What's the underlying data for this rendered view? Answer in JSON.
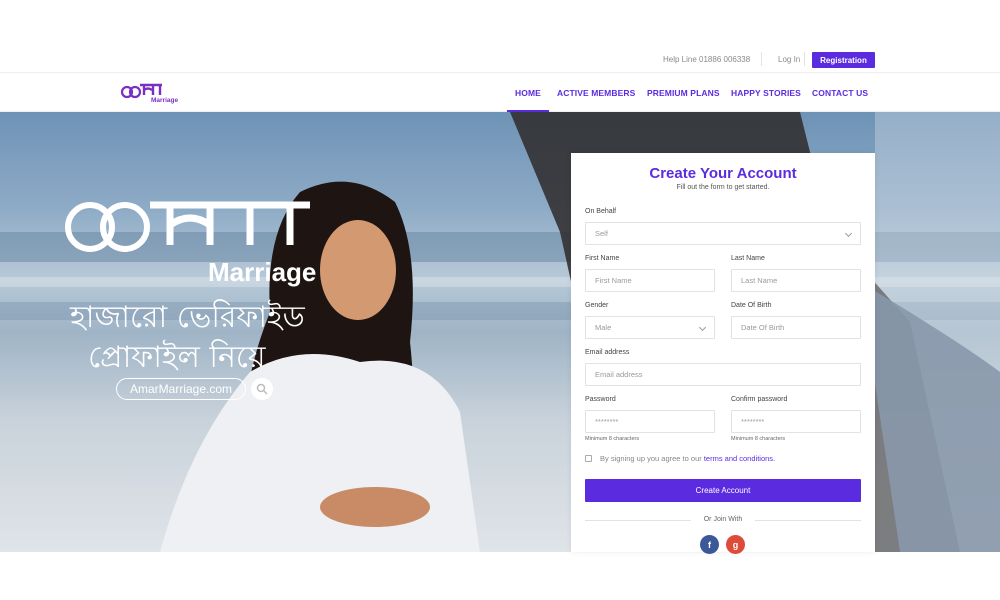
{
  "topbar": {
    "helpline": "Help Line 01886 006338",
    "login": "Log In",
    "register": "Registration"
  },
  "nav": {
    "items": [
      "HOME",
      "ACTIVE MEMBERS",
      "PREMIUM PLANS",
      "HAPPY STORIES",
      "CONTACT US"
    ],
    "active": "HOME"
  },
  "logo": {
    "text": "Marriage"
  },
  "hero": {
    "brand_line1": "Marriage",
    "tagline_line1": "হাজারো ভেরিফাইড",
    "tagline_line2": "প্রোফাইল নিয়ে",
    "url": "AmarMarriage.com"
  },
  "form": {
    "title": "Create Your Account",
    "subtitle": "Fill out the form to get started.",
    "on_behalf_label": "On Behalf",
    "on_behalf_value": "Self",
    "first_name_label": "First Name",
    "first_name_placeholder": "First Name",
    "last_name_label": "Last Name",
    "last_name_placeholder": "Last Name",
    "gender_label": "Gender",
    "gender_value": "Male",
    "dob_label": "Date Of Birth",
    "dob_placeholder": "Date Of Birth",
    "email_label": "Email address",
    "email_placeholder": "Email address",
    "password_label": "Password",
    "password_placeholder": "********",
    "password_hint": "Minimum 8 characters",
    "confirm_label": "Confirm password",
    "confirm_placeholder": "********",
    "confirm_hint": "Minimum 8 characters",
    "agree_text": "By signing up you agree to our",
    "terms_link": "terms and conditions.",
    "submit": "Create Account",
    "or_join": "Or Join With",
    "facebook": "f",
    "google": "g"
  },
  "colors": {
    "accent": "#5b2be0",
    "facebook": "#3b5998",
    "google": "#dd4b39"
  }
}
